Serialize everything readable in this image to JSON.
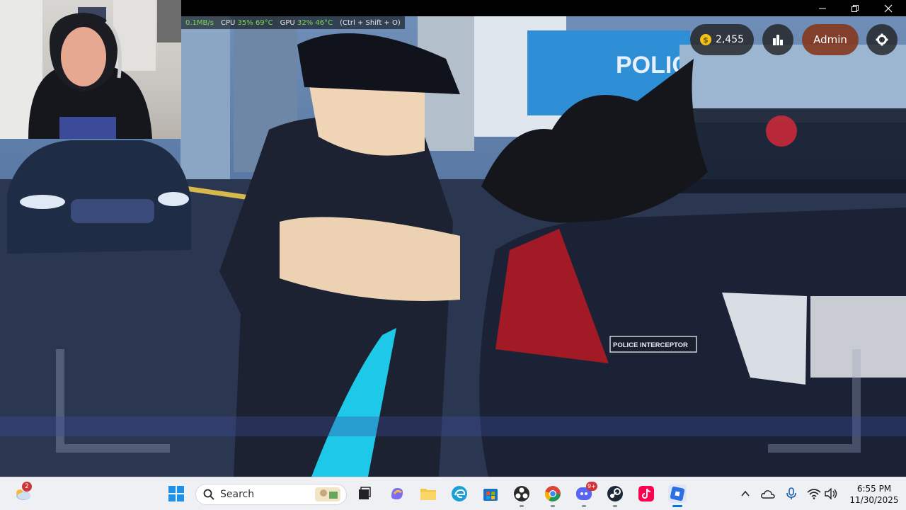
{
  "perf": {
    "net": "0.1MB/s",
    "cpu_label": "CPU",
    "cpu_usage": "35%",
    "cpu_temp": "69°C",
    "gpu_label": "GPU",
    "gpu_usage": "32%",
    "gpu_temp": "46°C",
    "hint": "(Ctrl + Shift + O)"
  },
  "hud": {
    "coins": "2,455",
    "coin_symbol": "$",
    "admin_label": "Admin"
  },
  "scene": {
    "station_sign": "POLICE",
    "plate_text": "POLICE INTERCEPTOR"
  },
  "taskbar": {
    "search_placeholder": "Search",
    "weather_badge": "2",
    "discord_badge": "9+",
    "time": "6:55 PM",
    "date": "11/30/2025"
  },
  "colors": {
    "accent_blue": "#0078d4",
    "badge_red": "#d13438",
    "admin_orange": "#843419",
    "perf_green": "#7ed957"
  }
}
